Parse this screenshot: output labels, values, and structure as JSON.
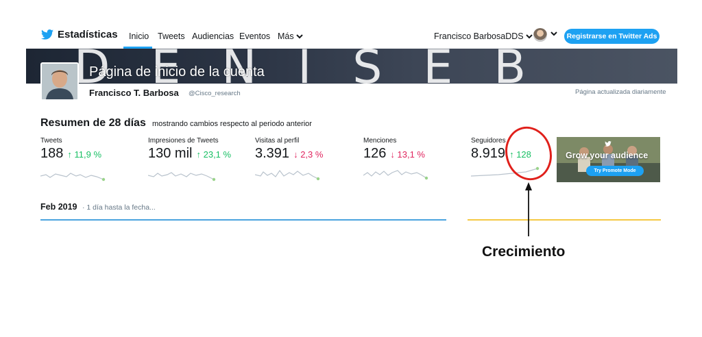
{
  "nav": {
    "brand": "Estadísticas",
    "links": [
      "Inicio",
      "Tweets",
      "Audiencias",
      "Eventos"
    ],
    "more": "Más",
    "user": "Francisco BarbosaDDS",
    "ads_button": "Registrarse en Twitter Ads",
    "accent_color": "#1da1f2"
  },
  "banner": {
    "letters": "DENISEB",
    "title": "Página de inicio de la cuenta"
  },
  "profile": {
    "name": "Francisco T. Barbosa",
    "handle": "@Cisco_research",
    "updated": "Página actualizada diariamente"
  },
  "summary": {
    "title": "Resumen de 28 días",
    "subtitle": "mostrando cambios respecto al periodo anterior"
  },
  "stats": [
    {
      "label": "Tweets",
      "value": "188",
      "change": "11,9 %",
      "direction": "up",
      "arrow": "↑"
    },
    {
      "label": "Impresiones de Tweets",
      "value": "130 mil",
      "change": "23,1 %",
      "direction": "up",
      "arrow": "↑"
    },
    {
      "label": "Visitas al perfil",
      "value": "3.391",
      "change": "2,3 %",
      "direction": "down",
      "arrow": "↓"
    },
    {
      "label": "Menciones",
      "value": "126",
      "change": "13,1 %",
      "direction": "down",
      "arrow": "↓"
    },
    {
      "label": "Seguidores",
      "value": "8.919",
      "change": "128",
      "direction": "up",
      "arrow": "↑"
    }
  ],
  "promo": {
    "title": "Grow your audience",
    "button": "Try Promote Mode"
  },
  "month": {
    "title": "Feb 2019",
    "subtitle": "· 1 día hasta la fecha..."
  },
  "annotation": {
    "label": "Crecimiento",
    "color": "#e0201b"
  }
}
